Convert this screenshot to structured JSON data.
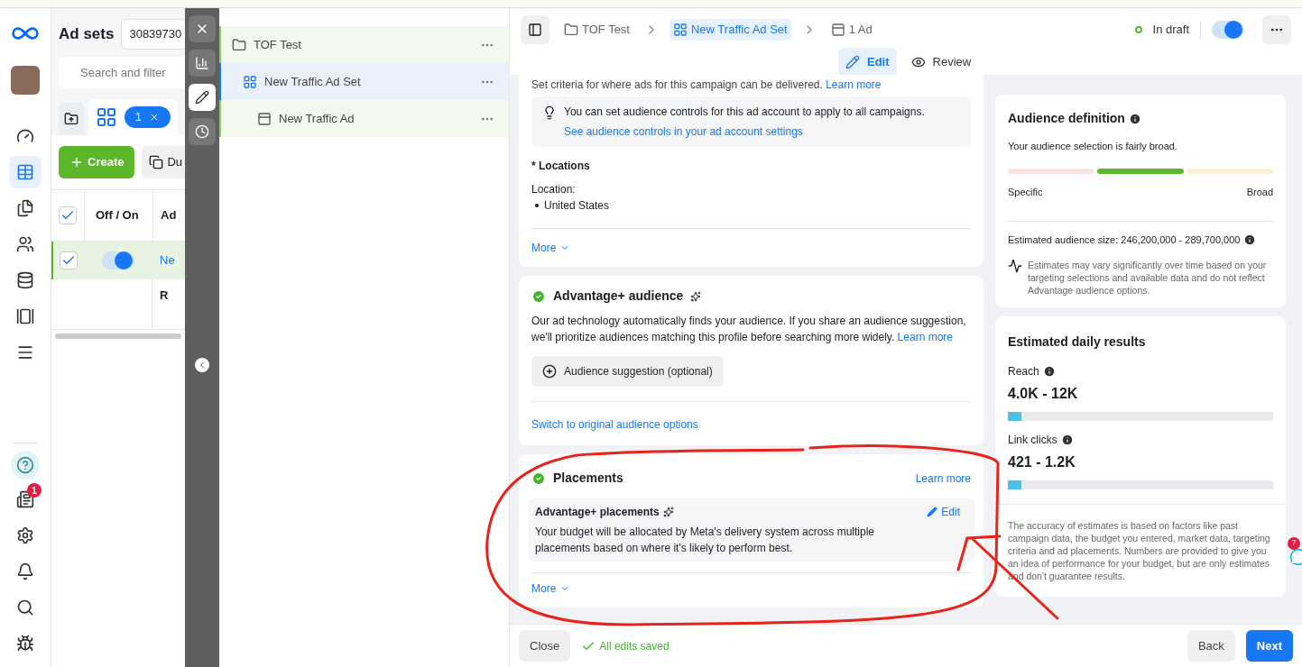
{
  "nav": {
    "notification_badge": "1"
  },
  "adsets_panel": {
    "title": "Ad sets",
    "account": "30839730",
    "search_placeholder": "Search and filter",
    "filter_count": "1",
    "create_button": "Create",
    "duplicate_button": "Du",
    "columns": [
      "Off / On",
      "Ad"
    ],
    "header_checked": true,
    "rows": [
      {
        "checked": true,
        "on": true,
        "name": "Ne",
        "selected": true
      }
    ],
    "summary_row": "R"
  },
  "tree": [
    {
      "kind": "campaign",
      "name": "TOF Test",
      "selected": false
    },
    {
      "kind": "adset",
      "name": "New Traffic Ad Set",
      "selected": true
    },
    {
      "kind": "ad",
      "name": "New Traffic Ad",
      "selected": false
    }
  ],
  "breadcrumb": [
    {
      "kind": "campaign",
      "label": "TOF Test",
      "selected": false
    },
    {
      "kind": "adset",
      "label": "New Traffic Ad Set",
      "selected": true
    },
    {
      "kind": "ad",
      "label": "1 Ad",
      "selected": false
    }
  ],
  "status": "In draft",
  "publish_toggle_on": true,
  "mode_tabs": [
    {
      "kind": "edit",
      "label": "Edit",
      "selected": true
    },
    {
      "kind": "review",
      "label": "Review",
      "selected": false
    }
  ],
  "audience_controls": {
    "intro": "Set criteria for where ads for this campaign can be delivered.",
    "intro_link": "Learn more",
    "tip": "You can set audience controls for this ad account to apply to all campaigns.",
    "tip_link": "See audience controls in your ad account settings",
    "locations_label": "* Locations",
    "location_heading": "Location:",
    "locations": [
      "United States"
    ],
    "more": "More"
  },
  "advantage_audience": {
    "title": "Advantage+ audience",
    "done": true,
    "description": "Our ad technology automatically finds your audience. If you share an audience suggestion, we'll prioritize audiences matching this profile before searching more widely.",
    "learn_more": "Learn more",
    "suggestion_button": "Audience suggestion (optional)",
    "switch_link": "Switch to original audience options"
  },
  "placements": {
    "title": "Placements",
    "done": true,
    "learn_more": "Learn more",
    "option_title": "Advantage+ placements",
    "edit": "Edit",
    "description": "Your budget will be allocated by Meta's delivery system across multiple placements based on where it's likely to perform best.",
    "more": "More"
  },
  "audience_definition": {
    "title": "Audience definition",
    "summary": "Your audience selection is fairly broad.",
    "segments": [
      {
        "selected": false
      },
      {
        "selected": true
      },
      {
        "selected": false
      }
    ],
    "left_label": "Specific",
    "right_label": "Broad",
    "size": "Estimated audience size: 246,200,000 - 289,700,000",
    "note": "Estimates may vary significantly over time based on your targeting selections and available data and do not reflect Advantage audience options."
  },
  "daily_results": {
    "title": "Estimated daily results",
    "metrics": [
      {
        "label": "Reach",
        "value": "4.0K - 12K",
        "level": 0.05
      },
      {
        "label": "Link clicks",
        "value": "421 - 1.2K",
        "level": 0.05
      }
    ],
    "disclaimer": "The accuracy of estimates is based on factors like past campaign data, the budget you entered, market data, targeting criteria and ad placements. Numbers are provided to give you an idea of performance for your budget, but are only estimates and don't guarantee results."
  },
  "footer": {
    "close": "Close",
    "saved": "All edits saved",
    "back": "Back",
    "next": "Next"
  },
  "floating_badge": "7"
}
